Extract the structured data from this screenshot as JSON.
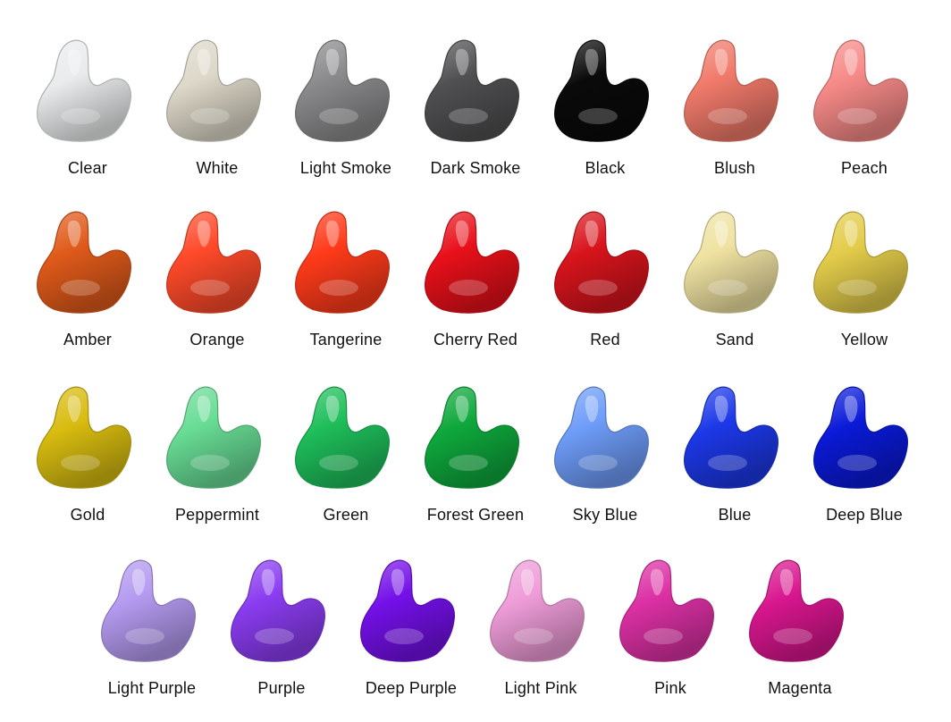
{
  "swatches": [
    {
      "name": "Clear",
      "color": "#e9ebec"
    },
    {
      "name": "White",
      "color": "#ddd8c8"
    },
    {
      "name": "Light Smoke",
      "color": "#8a8a8c"
    },
    {
      "name": "Dark Smoke",
      "color": "#505052"
    },
    {
      "name": "Black",
      "color": "#0a0a0a"
    },
    {
      "name": "Blush",
      "color": "#f07a6a"
    },
    {
      "name": "Peach",
      "color": "#f68a88"
    },
    {
      "name": "Amber",
      "color": "#e05a1a"
    },
    {
      "name": "Orange",
      "color": "#ff4a2a"
    },
    {
      "name": "Tangerine",
      "color": "#ff3a1a"
    },
    {
      "name": "Cherry Red",
      "color": "#e8101a"
    },
    {
      "name": "Red",
      "color": "#d8141c"
    },
    {
      "name": "Sand",
      "color": "#efe2a2"
    },
    {
      "name": "Yellow",
      "color": "#e3cc4a"
    },
    {
      "name": "Gold",
      "color": "#d8bc10"
    },
    {
      "name": "Peppermint",
      "color": "#68dc94"
    },
    {
      "name": "Green",
      "color": "#1ebe5a"
    },
    {
      "name": "Forest Green",
      "color": "#0ea83c"
    },
    {
      "name": "Sky Blue",
      "color": "#6e9cf8"
    },
    {
      "name": "Blue",
      "color": "#1c38e8"
    },
    {
      "name": "Deep Blue",
      "color": "#0a1ad8"
    },
    {
      "name": "Light Purple",
      "color": "#b49af0"
    },
    {
      "name": "Purple",
      "color": "#8a3cf0"
    },
    {
      "name": "Deep Purple",
      "color": "#7410e8"
    },
    {
      "name": "Light Pink",
      "color": "#ee9cd8"
    },
    {
      "name": "Pink",
      "color": "#dc30a4"
    },
    {
      "name": "Magenta",
      "color": "#d8168e"
    }
  ]
}
